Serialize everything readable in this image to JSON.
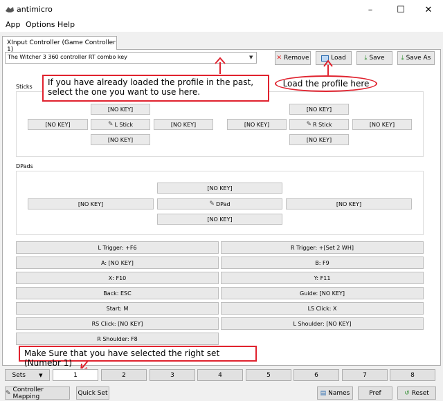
{
  "window": {
    "title": "antimicro",
    "minimize": "–",
    "maximize": "☐",
    "close": "✕"
  },
  "menu": {
    "items": [
      "App",
      "Options",
      "Help"
    ]
  },
  "tab": {
    "label": "XInput Controller (Game Controller 1)"
  },
  "profile": {
    "selected": "The Witcher 3 360 controller RT combo key"
  },
  "toolbar": {
    "remove": "Remove",
    "load": "Load",
    "save": "Save",
    "save_as": "Save As"
  },
  "annotations": {
    "select_profile": "If you have already loaded the profile in the past, select the one you  want to use here.",
    "load_profile": "Load the profile here",
    "make_sure": "Make Sure that you have selected the right set (Numebr 1)"
  },
  "sticks": {
    "label": "Sticks",
    "left": {
      "up": "[NO KEY]",
      "left": "[NO KEY]",
      "center": "L Stick",
      "right": "[NO KEY]",
      "down": "[NO KEY]"
    },
    "right": {
      "up": "[NO KEY]",
      "left": "[NO KEY]",
      "center": "R Stick",
      "right": "[NO KEY]",
      "down": "[NO KEY]"
    }
  },
  "dpads": {
    "label": "DPads",
    "up": "[NO KEY]",
    "left": "[NO KEY]",
    "center": "DPad",
    "right": "[NO KEY]",
    "down": "[NO KEY]"
  },
  "buttons": [
    "L Trigger: +F6",
    "R Trigger: +[Set 2 WH]",
    "A: [NO KEY]",
    "B: F9",
    "X: F10",
    "Y: F11",
    "Back: ESC",
    "Guide: [NO KEY]",
    "Start: M",
    "LS Click: X",
    "RS Click: [NO KEY]",
    "L Shoulder: [NO KEY]",
    "R Shoulder: F8"
  ],
  "sets": {
    "dropdown": "Sets",
    "items": [
      "1",
      "2",
      "3",
      "4",
      "5",
      "6",
      "7",
      "8"
    ]
  },
  "footer": {
    "controller_mapping": "Controller Mapping",
    "quick_set": "Quick Set",
    "names": "Names",
    "pref": "Pref",
    "reset": "Reset"
  },
  "colors": {
    "annotation_red": "#e0222e"
  }
}
